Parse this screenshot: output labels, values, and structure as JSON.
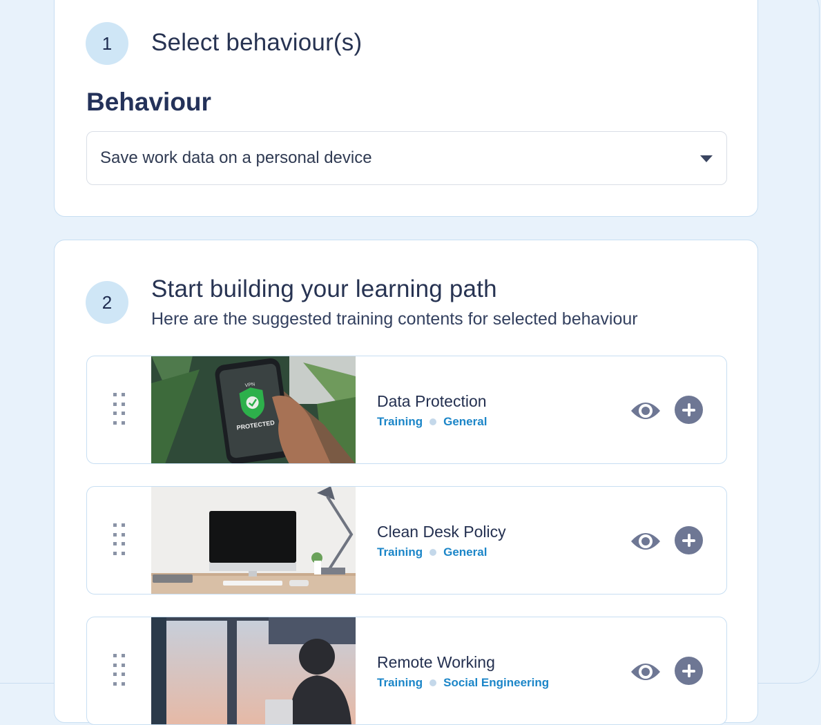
{
  "step1": {
    "number": "1",
    "title": "Select behaviour(s)",
    "field_label": "Behaviour",
    "selected_value": "Save work data on a personal device"
  },
  "step2": {
    "number": "2",
    "title": "Start building your learning path",
    "subtitle": "Here are the suggested training contents for selected behaviour",
    "items": [
      {
        "title": "Data Protection",
        "type": "Training",
        "category": "General",
        "thumb_text_1": "VPN",
        "thumb_text_2": "PROTECTED"
      },
      {
        "title": "Clean Desk Policy",
        "type": "Training",
        "category": "General"
      },
      {
        "title": "Remote Working",
        "type": "Training",
        "category": "Social Engineering"
      }
    ]
  },
  "icons": {
    "drag": "drag-handle-icon",
    "preview": "eye-icon",
    "add": "plus-circle-icon",
    "dropdown": "caret-down-icon"
  },
  "colors": {
    "accent_tag": "#1c86c8",
    "step_circle": "#cfe6f6",
    "action_icon": "#6e7794",
    "background": "#e8f2fb"
  }
}
